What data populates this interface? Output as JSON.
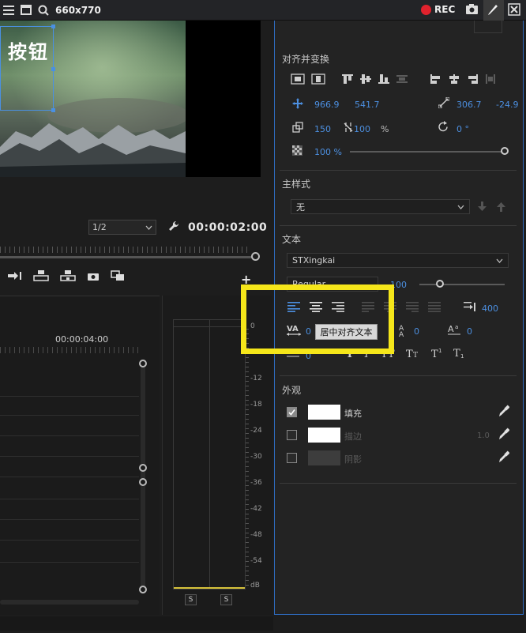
{
  "topbar": {
    "size_text": "660x770",
    "rec_label": "REC"
  },
  "preview": {
    "overlay_text": "按钮"
  },
  "playback": {
    "zoom_value": "1/2",
    "timecode": "00:00:02:00"
  },
  "timeline": {
    "time_label": "00:00:04:00"
  },
  "meter": {
    "db_labels": [
      "0",
      "-12",
      "-18",
      "-24",
      "-30",
      "-36",
      "-42",
      "-48",
      "-54",
      "dB"
    ],
    "solo_left": "S",
    "solo_right": "S"
  },
  "align": {
    "header": "对齐并变换",
    "pos_x": "966.9",
    "pos_y": "541.7",
    "anchor_x": "306.7",
    "anchor_y": "-24.9",
    "scale_w": "150",
    "scale_h": "100",
    "scale_unit": "%",
    "rotation": "0 °",
    "opacity": "100 %"
  },
  "master_style": {
    "header": "主样式",
    "value": "无"
  },
  "text": {
    "header": "文本",
    "font_family": "STXingkai",
    "font_style": "Regular",
    "font_size": "100",
    "tab_value": "400",
    "tracking_value": "0",
    "kerning_value": "0",
    "baseline_value": "0",
    "leading_value": "0",
    "tooltip": "居中对齐文本"
  },
  "appearance": {
    "header": "外观",
    "fill_label": "填充",
    "stroke_label": "描边",
    "stroke_width": "1.0",
    "shadow_label": "阴影"
  },
  "colors": {
    "accent": "#4c8fe0",
    "highlight": "#f5e61a",
    "rec": "#e0222d"
  }
}
